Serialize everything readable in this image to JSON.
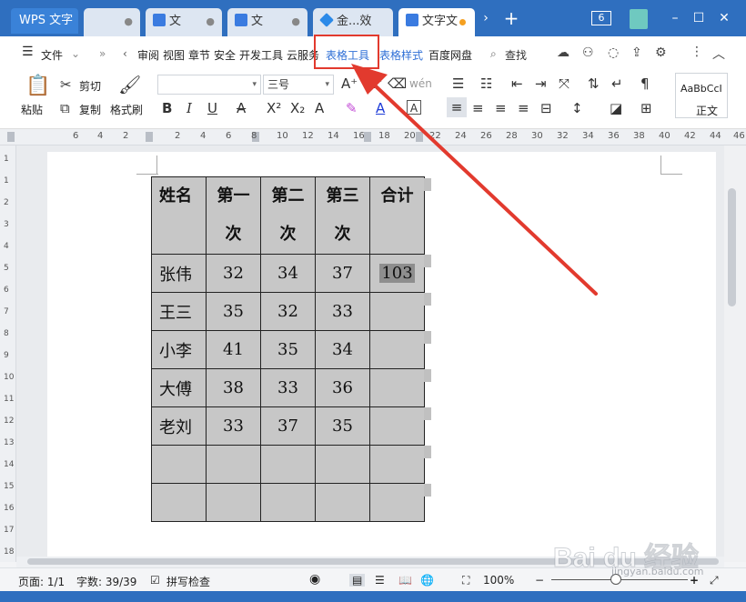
{
  "tabs": {
    "wps": "WPS 文字",
    "t2": "文",
    "t3": "文",
    "t4": "金...效",
    "t5": "文字文"
  },
  "window": {
    "badge": "6"
  },
  "menu": {
    "file": "文件",
    "items": [
      "审阅",
      "视图",
      "章节",
      "安全",
      "开发工具",
      "云服务"
    ],
    "table_tools": "表格工具",
    "table_style": "表格样式",
    "baidu_disk": "百度网盘",
    "search": "查找"
  },
  "toolbar": {
    "paste": "粘贴",
    "cut": "剪切",
    "copy": "复制",
    "format_painter": "格式刷",
    "font_name": "",
    "font_size": "三号",
    "style_preview": "AaBbCcI",
    "style_name": "正文"
  },
  "ruler": {
    "h": [
      "6",
      "4",
      "2",
      "2",
      "4",
      "6",
      "8",
      "10",
      "12",
      "14",
      "16",
      "18",
      "20",
      "22",
      "24",
      "26",
      "28",
      "30",
      "32",
      "34",
      "36",
      "38",
      "40",
      "42",
      "44",
      "46"
    ],
    "v": [
      "1",
      "1",
      "2",
      "3",
      "4",
      "5",
      "6",
      "7",
      "8",
      "9",
      "10",
      "11",
      "12",
      "13",
      "14",
      "15",
      "16",
      "17",
      "18"
    ]
  },
  "table": {
    "header": [
      [
        "姓名"
      ],
      [
        "第一",
        "次"
      ],
      [
        "第二",
        "次"
      ],
      [
        "第三",
        "次"
      ],
      [
        "合计"
      ]
    ],
    "rows": [
      [
        "张伟",
        "32",
        "34",
        "37",
        "103"
      ],
      [
        "王三",
        "35",
        "32",
        "33",
        ""
      ],
      [
        "小李",
        "41",
        "35",
        "34",
        ""
      ],
      [
        "大傅",
        "38",
        "33",
        "36",
        ""
      ],
      [
        "老刘",
        "33",
        "37",
        "35",
        ""
      ],
      [
        "",
        "",
        "",
        "",
        ""
      ],
      [
        "",
        "",
        "",
        "",
        ""
      ]
    ]
  },
  "status": {
    "page": "页面: 1/1",
    "words": "字数: 39/39",
    "spell": "拼写检查",
    "zoom": "100%"
  },
  "watermark": {
    "text": "Bai du 经验",
    "sub": "jingyan.baidu.com"
  },
  "colors": {
    "highlight_box": "#e23a2e",
    "arrow": "#e23a2e",
    "accent": "#2f6fd6",
    "tabbar": "#2f6fbf"
  }
}
